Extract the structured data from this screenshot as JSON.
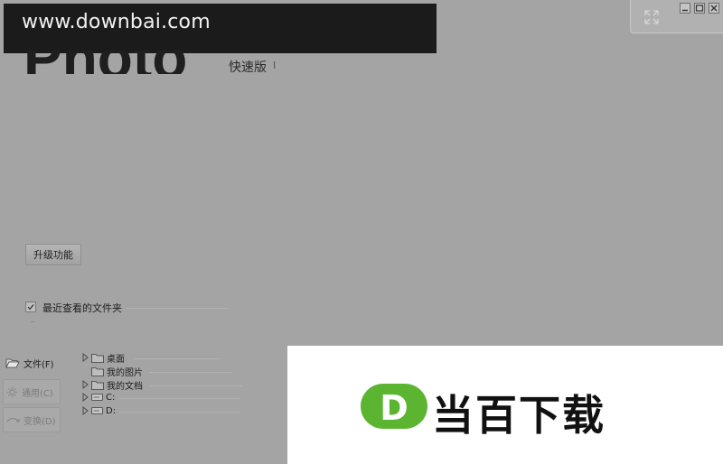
{
  "watermark": {
    "url_text": "www.downbai.com",
    "brand_text": "当百下载",
    "brand_letter": "D"
  },
  "app": {
    "logo_text": "Photo",
    "edition": "快速版",
    "edition_mark": "I"
  },
  "upgrade": {
    "label": "升级功能"
  },
  "recent": {
    "label": "最近查看的文件夹",
    "checked": true
  },
  "nav": [
    {
      "label": "文件(F)",
      "icon": "folder-open-icon",
      "enabled": true
    },
    {
      "label": "通用(C)",
      "icon": "gear-icon",
      "enabled": false
    },
    {
      "label": "变换(D)",
      "icon": "transform-icon",
      "enabled": false
    }
  ],
  "tree": [
    {
      "label": "桌面",
      "icon": "folder-icon",
      "expandable": true
    },
    {
      "label": "我的图片",
      "icon": "folder-icon",
      "expandable": false
    },
    {
      "label": "我的文档",
      "icon": "folder-icon",
      "expandable": true
    },
    {
      "label": "C:",
      "icon": "drive-icon",
      "expandable": true
    },
    {
      "label": "D:",
      "icon": "drive-icon",
      "expandable": true
    }
  ],
  "colors": {
    "background": "#a4a4a4",
    "banner": "#1b1b1b",
    "brand_green": "#5cb531"
  }
}
